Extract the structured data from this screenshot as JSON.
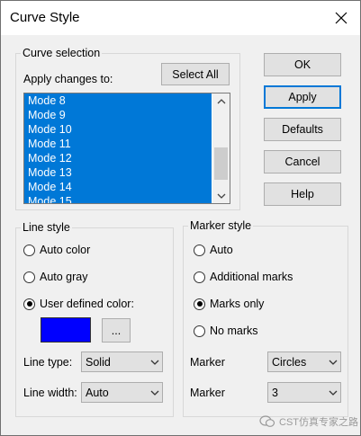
{
  "window": {
    "title": "Curve Style"
  },
  "accent_color": "#0078d7",
  "curve_selection": {
    "legend": "Curve selection",
    "apply_label": "Apply changes to:",
    "select_all": "Select All",
    "items": [
      "Mode 8",
      "Mode 9",
      "Mode 10",
      "Mode 11",
      "Mode 12",
      "Mode 13",
      "Mode 14",
      "Mode 15"
    ]
  },
  "buttons": {
    "ok": "OK",
    "apply": "Apply",
    "defaults": "Defaults",
    "cancel": "Cancel",
    "help": "Help"
  },
  "line_style": {
    "legend": "Line style",
    "options": [
      "Auto color",
      "Auto gray",
      "User defined color:"
    ],
    "selected": "User defined color:",
    "color": "#0000ff",
    "color_browse": "...",
    "type_label": "Line type:",
    "type_value": "Solid",
    "width_label": "Line width:",
    "width_value": "Auto"
  },
  "marker_style": {
    "legend": "Marker style",
    "options": [
      "Auto",
      "Additional marks",
      "Marks only",
      "No marks"
    ],
    "selected": "Marks only",
    "marker1_label": "Marker",
    "marker1_value": "Circles",
    "marker2_label": "Marker",
    "marker2_value": "3"
  },
  "watermark": {
    "text": "CST仿真专家之路"
  }
}
